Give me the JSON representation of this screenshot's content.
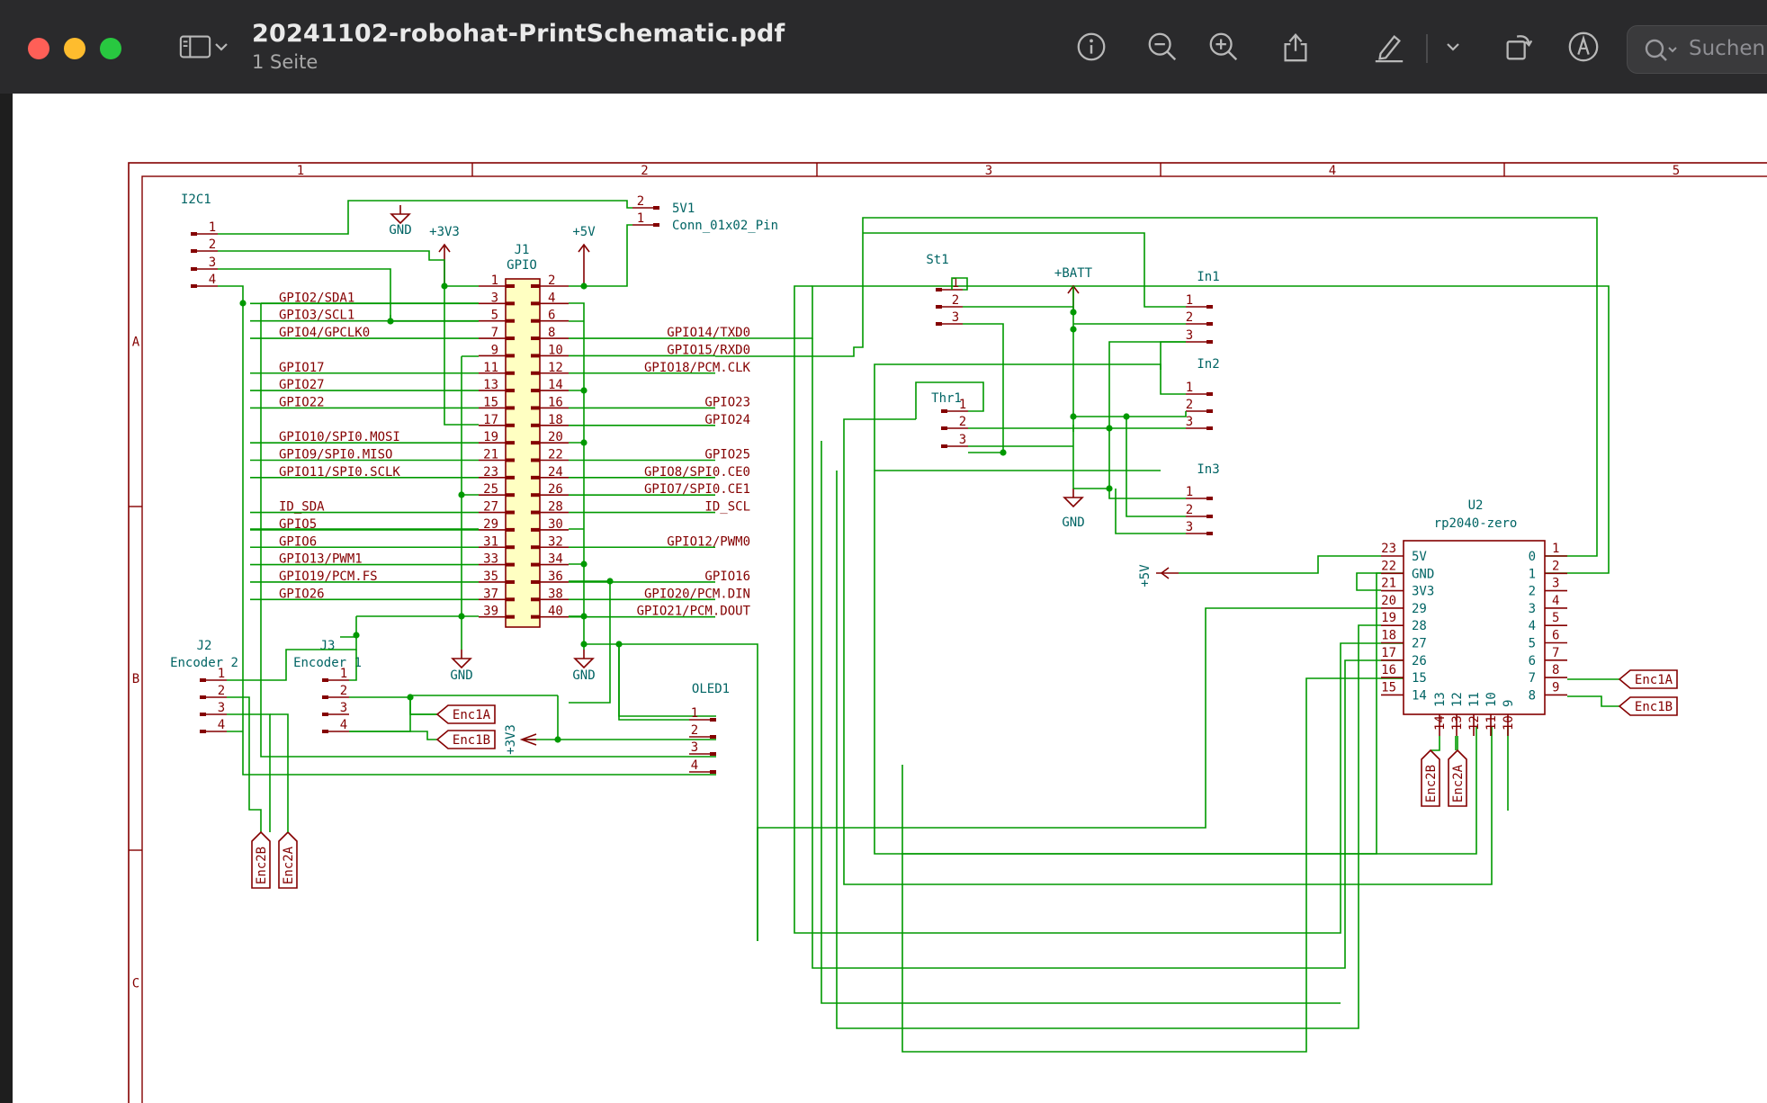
{
  "window": {
    "title": "20241102-robohat-PrintSchematic.pdf",
    "subtitle": "1 Seite",
    "search_placeholder": "Suchen"
  },
  "toolbar": {
    "icons": [
      "sidebar-icon",
      "chevron-down-icon",
      "info-icon",
      "zoom-out-icon",
      "zoom-in-icon",
      "share-icon",
      "highlight-icon",
      "chevron-down-icon",
      "rotate-icon",
      "markup-icon",
      "search-icon"
    ]
  },
  "colors": {
    "wire": "#009900",
    "symbol": "#840000",
    "net": "#006464",
    "frame": "#840000",
    "header_fill": "#ffffc2"
  },
  "schematic": {
    "frame_columns": [
      "1",
      "2",
      "3",
      "4",
      "5"
    ],
    "frame_rows": [
      "A",
      "B",
      "C"
    ],
    "components": {
      "i2c1": {
        "ref": "I2C1",
        "pins": [
          "1",
          "2",
          "3",
          "4"
        ]
      },
      "fivev1": {
        "ref": "5V1",
        "value": "Conn_01x02_Pin",
        "pins": [
          "2",
          "1"
        ]
      },
      "j1": {
        "ref": "J1",
        "value": "GPIO"
      },
      "j2": {
        "ref": "J2",
        "value": "Encoder 2",
        "pins": [
          "1",
          "2",
          "3",
          "4"
        ]
      },
      "j3": {
        "ref": "J3",
        "value": "Encoder 1",
        "pins": [
          "1",
          "2",
          "3",
          "4"
        ]
      },
      "oled1": {
        "ref": "OLED1",
        "pins": [
          "1",
          "2",
          "3",
          "4"
        ]
      },
      "st1": {
        "ref": "St1",
        "pins": [
          "1",
          "2",
          "3"
        ]
      },
      "thr1": {
        "ref": "Thr1",
        "pins": [
          "1",
          "2",
          "3"
        ]
      },
      "in1": {
        "ref": "In1",
        "pins": [
          "1",
          "2",
          "3"
        ]
      },
      "in2": {
        "ref": "In2",
        "pins": [
          "1",
          "2",
          "3"
        ]
      },
      "in3": {
        "ref": "In3",
        "pins": [
          "1",
          "2",
          "3"
        ]
      },
      "u2": {
        "ref": "U2",
        "value": "rp2040-zero",
        "left_pins": [
          {
            "num": "23",
            "name": "5V"
          },
          {
            "num": "22",
            "name": "GND"
          },
          {
            "num": "21",
            "name": "3V3"
          },
          {
            "num": "20",
            "name": "29"
          },
          {
            "num": "19",
            "name": "28"
          },
          {
            "num": "18",
            "name": "27"
          },
          {
            "num": "17",
            "name": "26"
          },
          {
            "num": "16",
            "name": "15"
          },
          {
            "num": "15",
            "name": "14"
          }
        ],
        "right_pins": [
          {
            "num": "1",
            "name": "0"
          },
          {
            "num": "2",
            "name": "1"
          },
          {
            "num": "3",
            "name": "2"
          },
          {
            "num": "4",
            "name": "3"
          },
          {
            "num": "5",
            "name": "4"
          },
          {
            "num": "6",
            "name": "5"
          },
          {
            "num": "7",
            "name": "6"
          },
          {
            "num": "8",
            "name": "7"
          },
          {
            "num": "9",
            "name": "8"
          }
        ],
        "bottom_names": [
          "13",
          "12",
          "11",
          "10",
          "9"
        ],
        "bottom_nums": [
          "14",
          "13",
          "12",
          "11",
          "10"
        ]
      }
    },
    "j1_left_pins": [
      {
        "num": "1",
        "label": ""
      },
      {
        "num": "3",
        "label": "GPIO2/SDA1"
      },
      {
        "num": "5",
        "label": "GPIO3/SCL1"
      },
      {
        "num": "7",
        "label": "GPIO4/GPCLK0"
      },
      {
        "num": "9",
        "label": ""
      },
      {
        "num": "11",
        "label": "GPIO17"
      },
      {
        "num": "13",
        "label": "GPIO27"
      },
      {
        "num": "15",
        "label": "GPIO22"
      },
      {
        "num": "17",
        "label": ""
      },
      {
        "num": "19",
        "label": "GPIO10/SPI0.MOSI"
      },
      {
        "num": "21",
        "label": "GPIO9/SPI0.MISO"
      },
      {
        "num": "23",
        "label": "GPIO11/SPI0.SCLK"
      },
      {
        "num": "25",
        "label": ""
      },
      {
        "num": "27",
        "label": "ID_SDA"
      },
      {
        "num": "29",
        "label": "GPIO5"
      },
      {
        "num": "31",
        "label": "GPIO6"
      },
      {
        "num": "33",
        "label": "GPIO13/PWM1"
      },
      {
        "num": "35",
        "label": "GPIO19/PCM.FS"
      },
      {
        "num": "37",
        "label": "GPIO26"
      },
      {
        "num": "39",
        "label": ""
      }
    ],
    "j1_right_pins": [
      {
        "num": "2",
        "label": ""
      },
      {
        "num": "4",
        "label": ""
      },
      {
        "num": "6",
        "label": ""
      },
      {
        "num": "8",
        "label": "GPIO14/TXD0"
      },
      {
        "num": "10",
        "label": "GPIO15/RXD0"
      },
      {
        "num": "12",
        "label": "GPIO18/PCM.CLK"
      },
      {
        "num": "14",
        "label": ""
      },
      {
        "num": "16",
        "label": "GPIO23"
      },
      {
        "num": "18",
        "label": "GPIO24"
      },
      {
        "num": "20",
        "label": ""
      },
      {
        "num": "22",
        "label": "GPIO25"
      },
      {
        "num": "24",
        "label": "GPIO8/SPI0.CE0"
      },
      {
        "num": "26",
        "label": "GPIO7/SPI0.CE1"
      },
      {
        "num": "28",
        "label": "ID_SCL"
      },
      {
        "num": "30",
        "label": ""
      },
      {
        "num": "32",
        "label": "GPIO12/PWM0"
      },
      {
        "num": "34",
        "label": ""
      },
      {
        "num": "36",
        "label": "GPIO16"
      },
      {
        "num": "38",
        "label": "GPIO20/PCM.DIN"
      },
      {
        "num": "40",
        "label": "GPIO21/PCM.DOUT"
      }
    ],
    "power_labels": {
      "gnd": "GND",
      "v3v3": "+3V3",
      "v5": "+5V",
      "vbatt": "+BATT"
    },
    "net_labels": {
      "enc1a": "Enc1A",
      "enc1b": "Enc1B",
      "enc2a": "Enc2A",
      "enc2b": "Enc2B"
    }
  }
}
